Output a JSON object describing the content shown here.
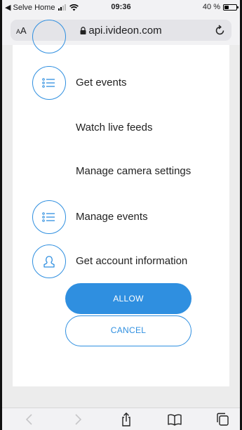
{
  "status_bar": {
    "back_app": "◀ Selve Home",
    "time": "09:36",
    "battery_percent": "40 %",
    "battery_level": 0.4
  },
  "address_bar": {
    "text_size_small": "A",
    "text_size_large": "A",
    "url": "api.ivideon.com"
  },
  "permissions": [
    {
      "label": "Get events",
      "icon": "list-icon"
    },
    {
      "label": "Watch live feeds",
      "icon": ""
    },
    {
      "label": "Manage camera settings",
      "icon": ""
    },
    {
      "label": "Manage events",
      "icon": "list-icon"
    },
    {
      "label": "Get account information",
      "icon": "user-icon"
    }
  ],
  "buttons": {
    "allow": "ALLOW",
    "cancel": "CANCEL"
  },
  "toolbar": {
    "icons": [
      "back-icon",
      "forward-icon",
      "share-icon",
      "bookmarks-icon",
      "tabs-icon"
    ]
  },
  "colors": {
    "accent": "#2f8fe0",
    "background": "#ececec",
    "card": "#ffffff",
    "chrome": "#f2f2f4"
  }
}
